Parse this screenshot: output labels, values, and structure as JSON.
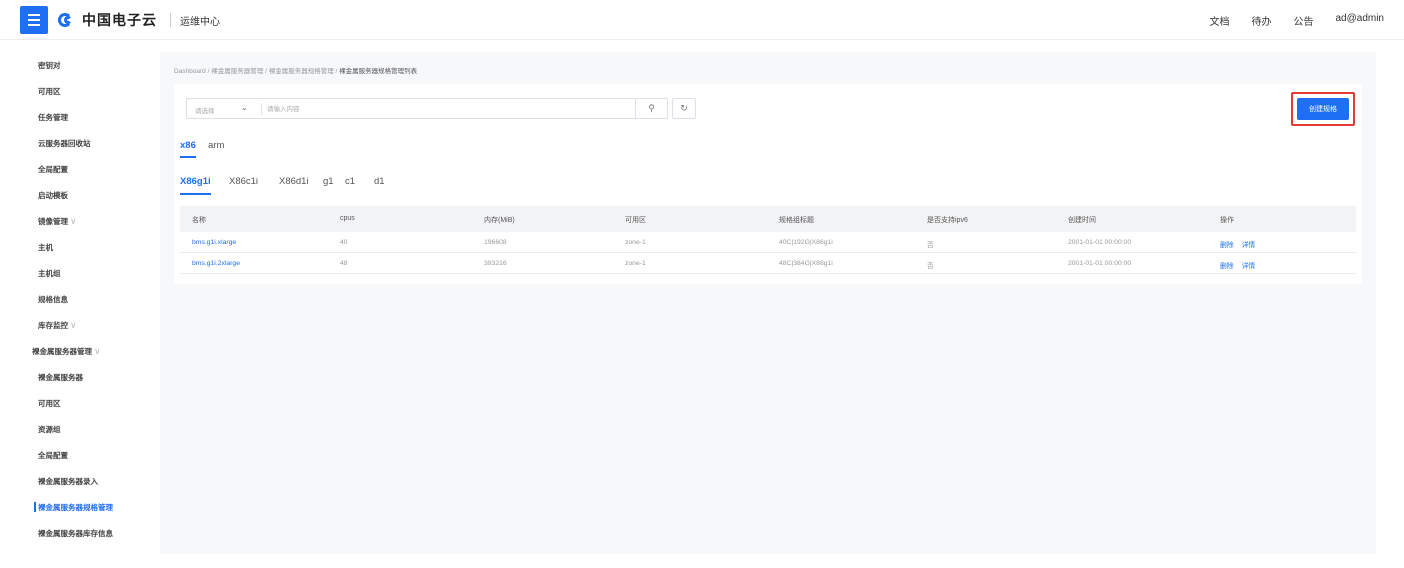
{
  "header": {
    "brand": "中国电子云",
    "app_name": "运维中心",
    "right_links": [
      "文档",
      "待办",
      "公告",
      "ad@admin"
    ]
  },
  "sidebar": {
    "items": [
      {
        "label": "密钥对",
        "level": 1
      },
      {
        "label": "可用区",
        "level": 1
      },
      {
        "label": "任务管理",
        "level": 1
      },
      {
        "label": "云服务器回收站",
        "level": 1
      },
      {
        "label": "全局配置",
        "level": 1
      },
      {
        "label": "启动模板",
        "level": 1
      },
      {
        "label": "镜像管理",
        "level": 1,
        "expandable": true
      },
      {
        "label": "主机",
        "level": 1
      },
      {
        "label": "主机组",
        "level": 1
      },
      {
        "label": "规格信息",
        "level": 1
      },
      {
        "label": "库存监控",
        "level": 1,
        "expandable": true
      },
      {
        "label": "裸金属服务器管理",
        "level": 0,
        "expandable": true
      },
      {
        "label": "裸金属服务器",
        "level": 1
      },
      {
        "label": "可用区",
        "level": 1
      },
      {
        "label": "资源组",
        "level": 1
      },
      {
        "label": "全局配置",
        "level": 1
      },
      {
        "label": "裸金属服务器录入",
        "level": 1
      },
      {
        "label": "裸金属服务器规格管理",
        "level": 1,
        "active": true
      },
      {
        "label": "裸金属服务器库存信息",
        "level": 1
      }
    ]
  },
  "breadcrumb": {
    "items": [
      "Dashboard",
      "裸金属服务器管理",
      "裸金属服务器规格管理",
      "裸金属服务器规格管理列表"
    ],
    "separator": "/"
  },
  "search": {
    "select_placeholder": "请选择",
    "input_placeholder": "请输入内容"
  },
  "create_button": "创建规格",
  "arch_tabs": [
    "x86",
    "arm"
  ],
  "arch_active": "x86",
  "family_tabs": [
    "X86g1i",
    "X86c1i",
    "X86d1i",
    "g1",
    "c1",
    "d1"
  ],
  "family_active": "X86g1i",
  "table": {
    "columns": [
      "名称",
      "cpus",
      "内存(MiB)",
      "可用区",
      "规格组标题",
      "是否支持ipv6",
      "创建时间",
      "操作"
    ],
    "rows": [
      {
        "name": "bms.g1i.xlarge",
        "cpus": "40",
        "memory": "196608",
        "zone": "zone-1",
        "title": "40C|192G|X86g1i",
        "ipv6": "否",
        "created": "2001-01-01 00:00:00",
        "ops": [
          "删除",
          "详情"
        ]
      },
      {
        "name": "bms.g1i.2xlarge",
        "cpus": "48",
        "memory": "393216",
        "zone": "zone-1",
        "title": "48C|384G|X86g1i",
        "ipv6": "否",
        "created": "2001-01-01 00:00:00",
        "ops": [
          "删除",
          "详情"
        ]
      }
    ]
  },
  "colors": {
    "accent": "#1f6ff2",
    "highlight_border": "#e53935"
  }
}
